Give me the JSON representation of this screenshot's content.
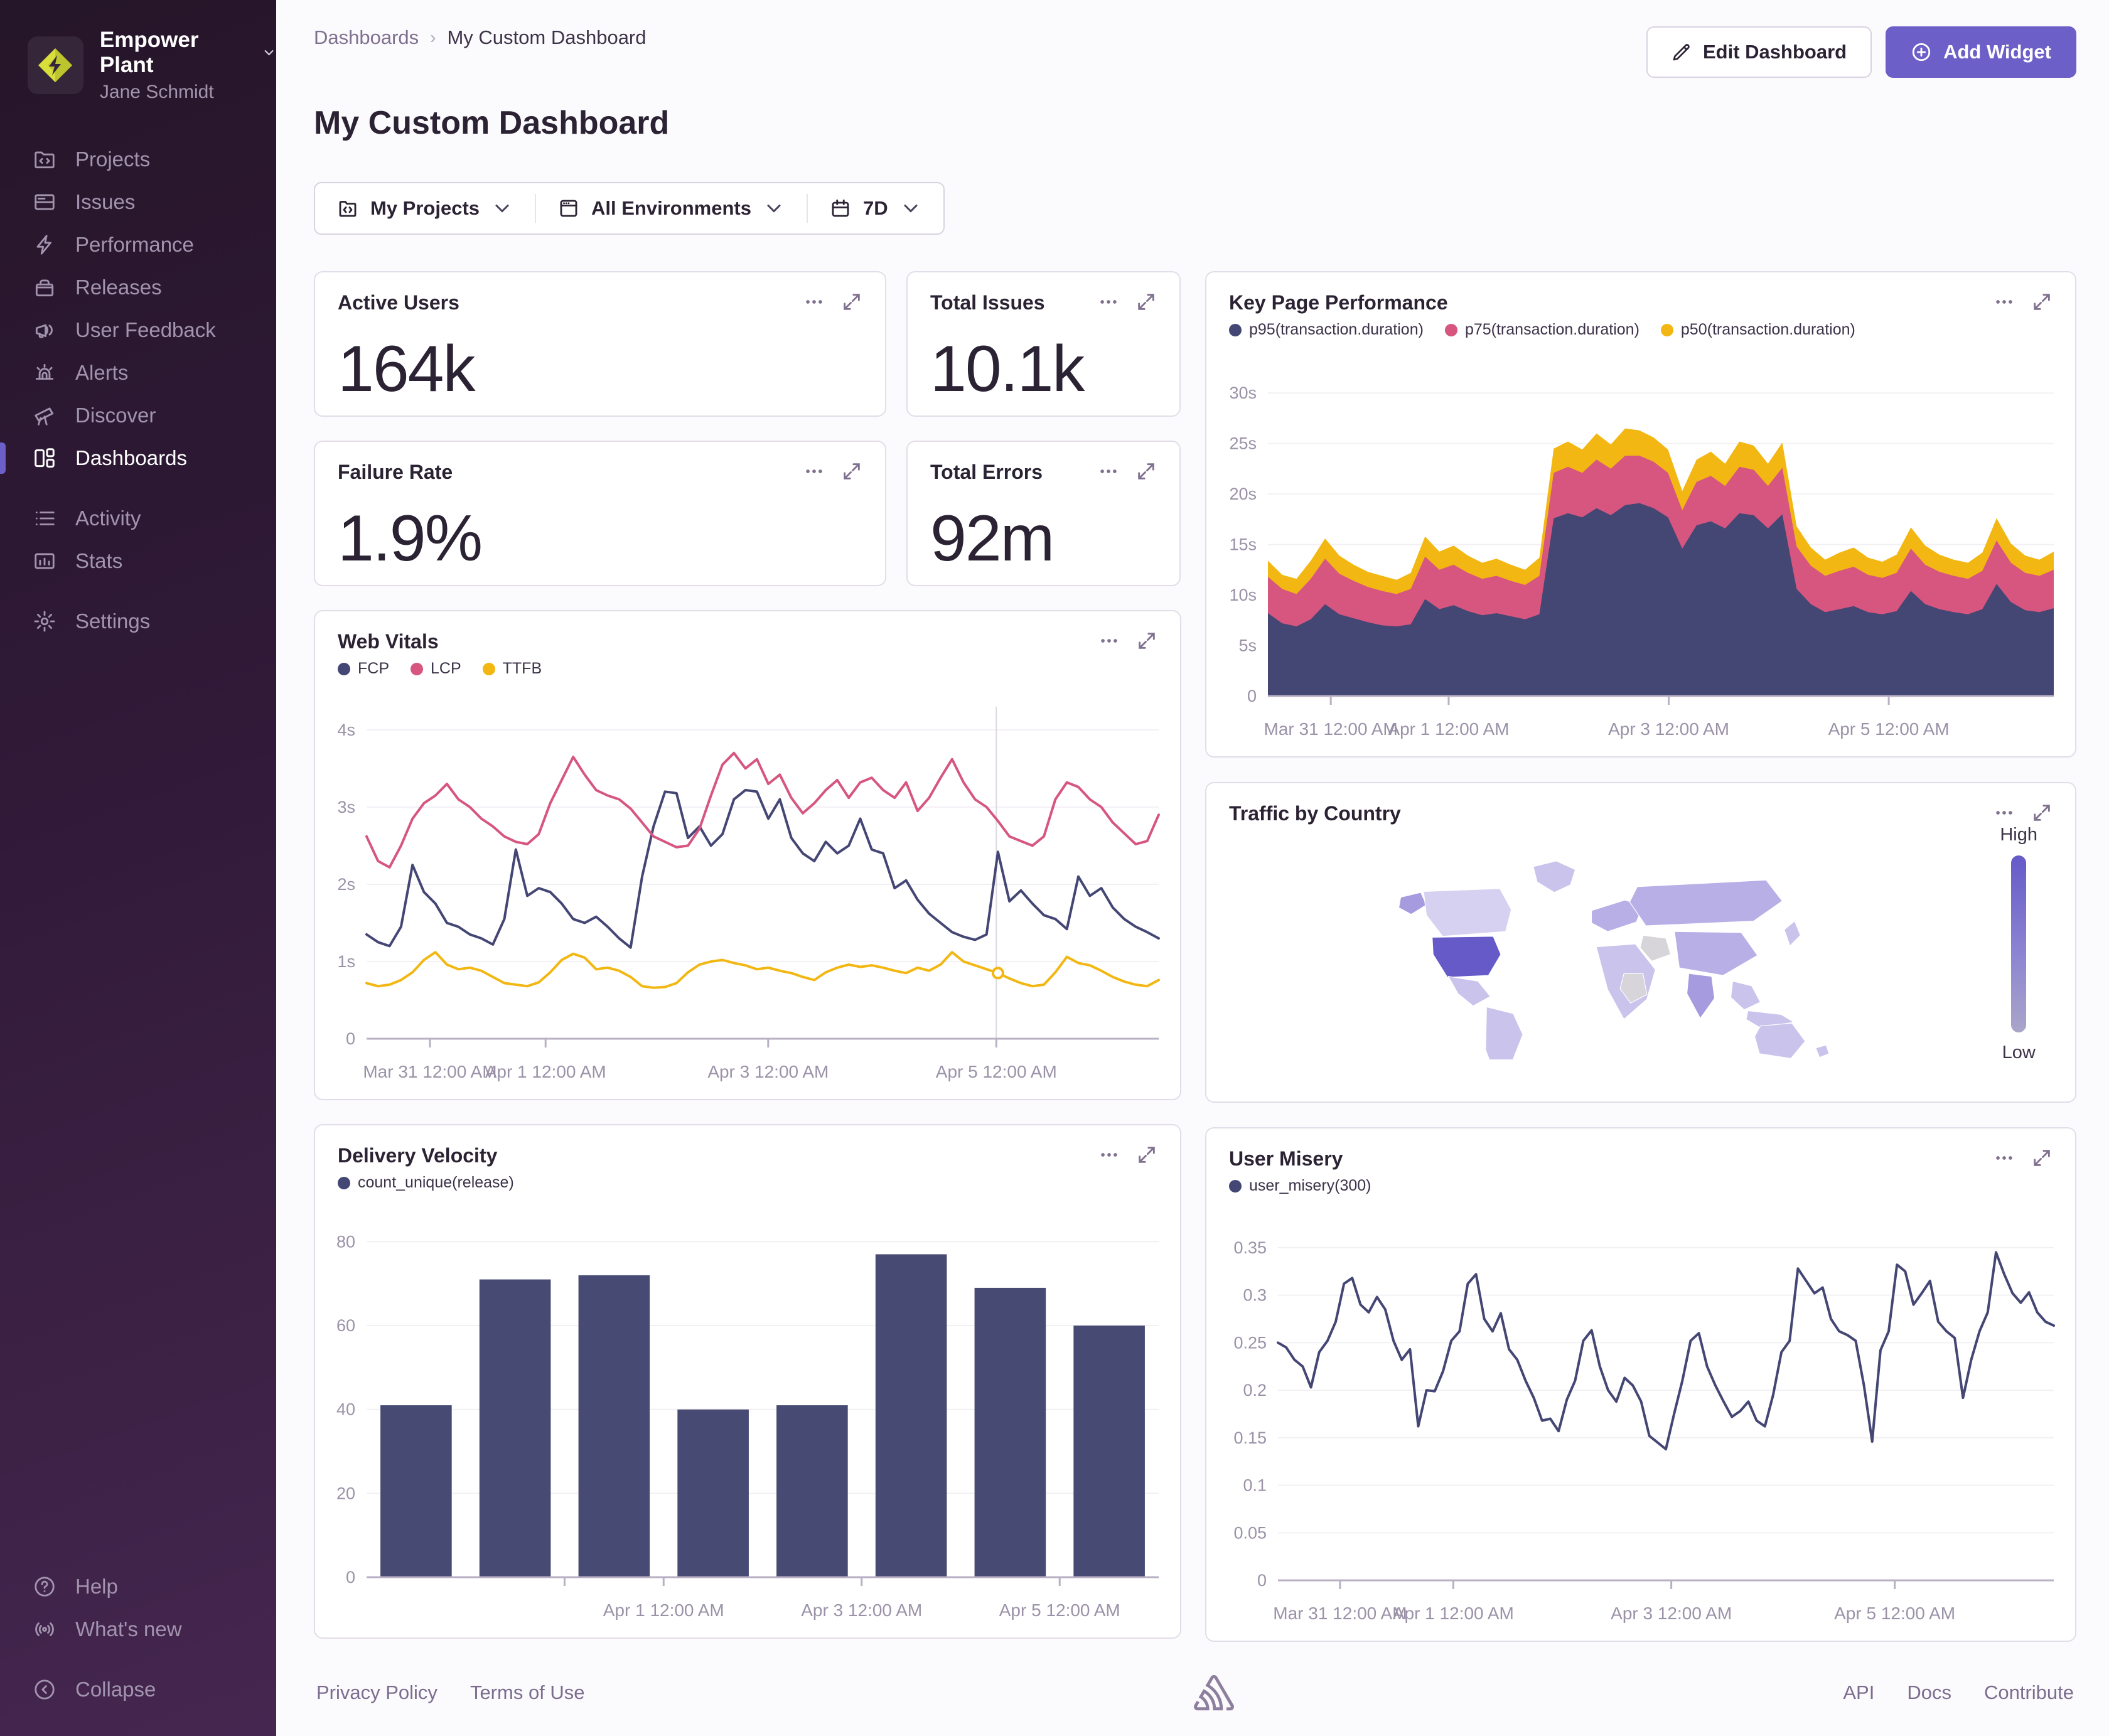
{
  "org": {
    "name": "Empower Plant",
    "user": "Jane Schmidt"
  },
  "sidebar": {
    "items": [
      {
        "label": "Projects"
      },
      {
        "label": "Issues"
      },
      {
        "label": "Performance"
      },
      {
        "label": "Releases"
      },
      {
        "label": "User Feedback"
      },
      {
        "label": "Alerts"
      },
      {
        "label": "Discover"
      },
      {
        "label": "Dashboards"
      },
      {
        "label": "Activity"
      },
      {
        "label": "Stats"
      },
      {
        "label": "Settings"
      }
    ],
    "bottom": [
      {
        "label": "Help"
      },
      {
        "label": "What's new"
      },
      {
        "label": "Collapse"
      }
    ]
  },
  "header": {
    "breadcrumb": [
      "Dashboards",
      "My Custom Dashboard"
    ],
    "title": "My Custom Dashboard",
    "edit_button": "Edit Dashboard",
    "add_button": "Add Widget"
  },
  "filters": {
    "projects": "My Projects",
    "environments": "All Environments",
    "daterange": "7D"
  },
  "widgets": {
    "active_users": {
      "title": "Active Users",
      "value": "164k"
    },
    "total_issues": {
      "title": "Total Issues",
      "value": "10.1k"
    },
    "failure_rate": {
      "title": "Failure Rate",
      "value": "1.9%"
    },
    "total_errors": {
      "title": "Total Errors",
      "value": "92m"
    },
    "key_page_performance": {
      "title": "Key Page Performance"
    },
    "web_vitals": {
      "title": "Web Vitals"
    },
    "traffic_by_country": {
      "title": "Traffic by Country",
      "legend_high": "High",
      "legend_low": "Low"
    },
    "delivery_velocity": {
      "title": "Delivery Velocity"
    },
    "user_misery": {
      "title": "User Misery"
    }
  },
  "footer": {
    "left_links": [
      "Privacy Policy",
      "Terms of Use"
    ],
    "right_links": [
      "API",
      "Docs",
      "Contribute"
    ]
  },
  "colors": {
    "accent": "#6C5FC7",
    "navy": "#444674",
    "pink": "#D6567F",
    "gold": "#F2B712",
    "sidebar_top": "#2F1937",
    "sidebar_bottom": "#452650",
    "map_base": "#CAC3EC",
    "map_high": "#655AC8",
    "map_none": "#D7D4DA"
  },
  "chart_data": [
    {
      "id": "key_page_performance",
      "type": "area",
      "stacked": true,
      "grid": true,
      "legend_position": "top",
      "title": "Key Page Performance",
      "ylim": [
        0,
        32.5
      ],
      "y_tick_values": [
        0,
        5,
        10,
        15,
        20,
        25,
        30
      ],
      "y_tick_labels": [
        "0",
        "5s",
        "10s",
        "15s",
        "20s",
        "25s",
        "30s"
      ],
      "x_labels": [
        "Mar 31 12:00 AM",
        "Apr 1 12:00 AM",
        "Apr 3 12:00 AM",
        "Apr 5 12:00 AM"
      ],
      "x_label_fractions": [
        0.08,
        0.23,
        0.51,
        0.79
      ],
      "x_tick_fractions": [
        0.08,
        0.23,
        0.51,
        0.79
      ],
      "series": [
        {
          "name": "p95(transaction.duration)",
          "color": "#444674",
          "values": [
            8.2,
            7.2,
            6.9,
            7.6,
            9.1,
            8.1,
            7.7,
            7.3,
            7.0,
            6.9,
            7.1,
            9.6,
            8.6,
            9.0,
            8.4,
            8.0,
            8.2,
            7.9,
            7.6,
            8.1,
            17.6,
            18.1,
            17.7,
            18.6,
            17.9,
            18.9,
            19.1,
            18.6,
            17.7,
            14.6,
            16.9,
            17.3,
            16.6,
            18.1,
            17.9,
            16.6,
            18.0,
            10.6,
            9.1,
            8.3,
            8.6,
            8.9,
            8.3,
            8.1,
            8.4,
            10.4,
            9.1,
            8.6,
            8.3,
            8.1,
            8.6,
            11.1,
            9.3,
            8.5,
            8.3,
            8.7
          ]
        },
        {
          "name": "p75(transaction.duration)",
          "color": "#D6567F",
          "values": [
            3.6,
            3.4,
            3.2,
            4.0,
            4.5,
            4.0,
            3.7,
            3.5,
            3.4,
            3.2,
            3.5,
            4.2,
            3.9,
            4.0,
            3.8,
            3.6,
            3.7,
            3.5,
            3.4,
            3.8,
            4.5,
            4.6,
            4.4,
            4.8,
            4.6,
            4.9,
            4.7,
            4.6,
            4.4,
            3.8,
            4.3,
            4.5,
            4.2,
            4.6,
            4.5,
            4.2,
            4.6,
            4.2,
            3.8,
            3.6,
            3.8,
            3.9,
            3.7,
            3.6,
            3.8,
            4.2,
            3.9,
            3.7,
            3.6,
            3.5,
            3.8,
            4.3,
            3.9,
            3.7,
            3.6,
            3.8
          ]
        },
        {
          "name": "p50(transaction.duration)",
          "color": "#F2B712",
          "values": [
            1.6,
            1.4,
            1.5,
            1.8,
            2.0,
            1.8,
            1.6,
            1.5,
            1.5,
            1.4,
            1.6,
            2.0,
            1.8,
            1.9,
            1.7,
            1.6,
            1.7,
            1.6,
            1.5,
            1.8,
            2.4,
            2.5,
            2.3,
            2.6,
            2.4,
            2.7,
            2.5,
            2.4,
            2.3,
            1.9,
            2.2,
            2.4,
            2.2,
            2.5,
            2.4,
            2.2,
            2.5,
            2.0,
            1.8,
            1.6,
            1.8,
            1.9,
            1.7,
            1.6,
            1.8,
            2.1,
            1.9,
            1.7,
            1.6,
            1.6,
            1.8,
            2.2,
            1.9,
            1.7,
            1.6,
            1.8
          ]
        }
      ]
    },
    {
      "id": "web_vitals",
      "type": "line",
      "grid": true,
      "legend_position": "top",
      "title": "Web Vitals",
      "ylim": [
        0,
        4.3
      ],
      "y_tick_values": [
        0,
        1,
        2,
        3,
        4
      ],
      "y_tick_labels": [
        "0",
        "1s",
        "2s",
        "3s",
        "4s"
      ],
      "x_labels": [
        "Mar 31 12:00 AM",
        "Apr 1 12:00 AM",
        "Apr 3 12:00 AM",
        "Apr 5 12:00 AM"
      ],
      "x_label_fractions": [
        0.08,
        0.226,
        0.507,
        0.795
      ],
      "x_tick_fractions": [
        0.08,
        0.226,
        0.507,
        0.795
      ],
      "crosshair": {
        "x_fraction": 0.795,
        "marker_series": 2
      },
      "series": [
        {
          "name": "FCP",
          "color": "#444674",
          "values": [
            1.35,
            1.25,
            1.2,
            1.45,
            2.25,
            1.9,
            1.75,
            1.5,
            1.45,
            1.35,
            1.3,
            1.22,
            1.55,
            2.45,
            1.85,
            1.95,
            1.9,
            1.75,
            1.55,
            1.5,
            1.58,
            1.45,
            1.3,
            1.18,
            2.1,
            2.75,
            3.2,
            3.18,
            2.6,
            2.75,
            2.5,
            2.65,
            3.1,
            3.22,
            3.2,
            2.85,
            3.1,
            2.6,
            2.4,
            2.3,
            2.55,
            2.4,
            2.5,
            2.85,
            2.45,
            2.4,
            1.95,
            2.05,
            1.8,
            1.62,
            1.5,
            1.38,
            1.32,
            1.28,
            1.35,
            2.42,
            1.78,
            1.92,
            1.75,
            1.6,
            1.55,
            1.42,
            2.1,
            1.85,
            1.95,
            1.7,
            1.55,
            1.45,
            1.38,
            1.3
          ]
        },
        {
          "name": "LCP",
          "color": "#D6567F",
          "values": [
            2.62,
            2.3,
            2.22,
            2.5,
            2.85,
            3.05,
            3.15,
            3.3,
            3.1,
            3.0,
            2.85,
            2.75,
            2.62,
            2.55,
            2.52,
            2.65,
            3.05,
            3.35,
            3.65,
            3.42,
            3.22,
            3.15,
            3.1,
            2.98,
            2.8,
            2.62,
            2.55,
            2.48,
            2.5,
            2.72,
            3.15,
            3.55,
            3.7,
            3.5,
            3.62,
            3.3,
            3.42,
            3.12,
            2.92,
            3.05,
            3.22,
            3.35,
            3.12,
            3.32,
            3.38,
            3.22,
            3.12,
            3.32,
            2.95,
            3.12,
            3.38,
            3.62,
            3.32,
            3.1,
            3.0,
            2.82,
            2.62,
            2.56,
            2.5,
            2.62,
            3.1,
            3.32,
            3.26,
            3.1,
            3.0,
            2.8,
            2.66,
            2.52,
            2.56,
            2.9
          ]
        },
        {
          "name": "TTFB",
          "color": "#F2B712",
          "values": [
            0.72,
            0.68,
            0.7,
            0.76,
            0.86,
            1.02,
            1.12,
            0.96,
            0.9,
            0.92,
            0.88,
            0.8,
            0.72,
            0.7,
            0.68,
            0.73,
            0.86,
            1.02,
            1.1,
            1.05,
            0.9,
            0.92,
            0.88,
            0.8,
            0.68,
            0.66,
            0.67,
            0.72,
            0.86,
            0.96,
            1.0,
            1.02,
            0.98,
            0.95,
            0.9,
            0.92,
            0.88,
            0.85,
            0.8,
            0.76,
            0.86,
            0.92,
            0.96,
            0.93,
            0.95,
            0.92,
            0.88,
            0.85,
            0.92,
            0.88,
            0.96,
            1.12,
            1.0,
            0.95,
            0.9,
            0.85,
            0.78,
            0.72,
            0.68,
            0.7,
            0.86,
            1.06,
            0.98,
            0.95,
            0.88,
            0.8,
            0.74,
            0.7,
            0.68,
            0.76
          ]
        }
      ]
    },
    {
      "id": "delivery_velocity",
      "type": "bar",
      "grid": true,
      "legend_position": "top",
      "title": "Delivery Velocity",
      "ylim": [
        0,
        85
      ],
      "y_tick_values": [
        0,
        20,
        40,
        60,
        80
      ],
      "y_tick_labels": [
        "0",
        "20",
        "40",
        "60",
        "80"
      ],
      "x_labels": [
        "Apr 1 12:00 AM",
        "Apr 3 12:00 AM",
        "Apr 5 12:00 AM"
      ],
      "x_label_fractions": [
        0.375,
        0.625,
        0.875
      ],
      "x_tick_fractions": [
        0.25,
        0.375,
        0.625,
        0.875
      ],
      "series": [
        {
          "name": "count_unique(release)",
          "color": "#474A73",
          "values": [
            41,
            71,
            72,
            40,
            41,
            77,
            69,
            60
          ]
        }
      ]
    },
    {
      "id": "user_misery",
      "type": "line",
      "grid": true,
      "legend_position": "top",
      "title": "User Misery",
      "ylim": [
        0,
        0.375
      ],
      "y_tick_values": [
        0,
        0.05,
        0.1,
        0.15,
        0.2,
        0.25,
        0.3,
        0.35
      ],
      "y_tick_labels": [
        "0",
        "0.05",
        "0.1",
        "0.15",
        "0.2",
        "0.25",
        "0.3",
        "0.35"
      ],
      "x_labels": [
        "Mar 31 12:00 AM",
        "Apr 1 12:00 AM",
        "Apr 3 12:00 AM",
        "Apr 5 12:00 AM"
      ],
      "x_label_fractions": [
        0.08,
        0.226,
        0.507,
        0.795
      ],
      "x_tick_fractions": [
        0.08,
        0.226,
        0.507,
        0.795
      ],
      "series": [
        {
          "name": "user_misery(300)",
          "color": "#444674",
          "values": [
            0.25,
            0.245,
            0.232,
            0.225,
            0.203,
            0.24,
            0.252,
            0.272,
            0.312,
            0.318,
            0.29,
            0.282,
            0.298,
            0.285,
            0.252,
            0.232,
            0.243,
            0.162,
            0.2,
            0.199,
            0.22,
            0.252,
            0.262,
            0.312,
            0.322,
            0.275,
            0.262,
            0.281,
            0.243,
            0.232,
            0.21,
            0.192,
            0.168,
            0.17,
            0.157,
            0.19,
            0.21,
            0.252,
            0.263,
            0.225,
            0.2,
            0.188,
            0.213,
            0.205,
            0.188,
            0.152,
            0.145,
            0.138,
            0.175,
            0.21,
            0.252,
            0.26,
            0.225,
            0.205,
            0.188,
            0.172,
            0.178,
            0.188,
            0.168,
            0.162,
            0.195,
            0.24,
            0.252,
            0.328,
            0.315,
            0.302,
            0.308,
            0.275,
            0.262,
            0.258,
            0.252,
            0.205,
            0.146,
            0.242,
            0.262,
            0.332,
            0.325,
            0.29,
            0.302,
            0.315,
            0.272,
            0.262,
            0.255,
            0.192,
            0.232,
            0.262,
            0.282,
            0.345,
            0.322,
            0.302,
            0.292,
            0.303,
            0.282,
            0.272,
            0.268
          ]
        }
      ]
    }
  ]
}
